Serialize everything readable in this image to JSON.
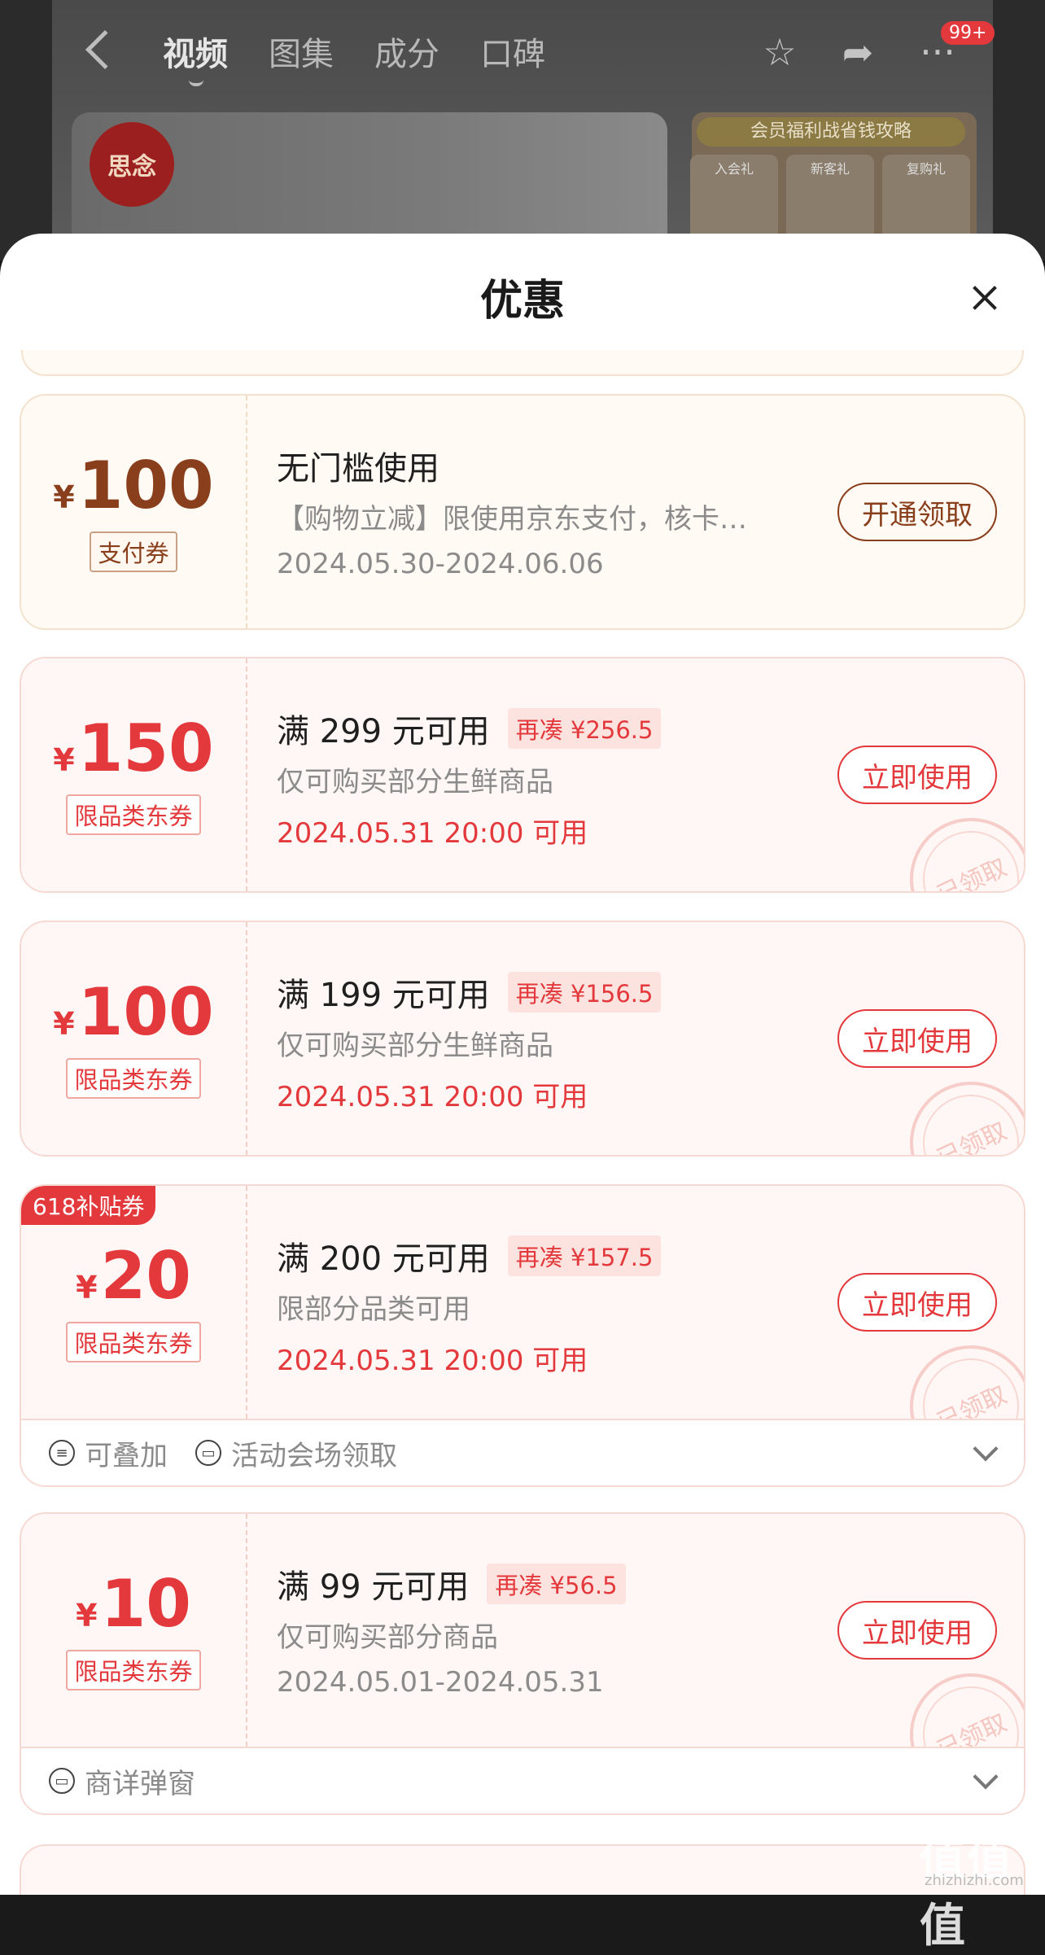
{
  "background_app": {
    "tabs": [
      "视频",
      "图集",
      "成分",
      "口碑"
    ],
    "active_tab": "视频",
    "badge": "99+",
    "logo_text": "思念",
    "banner_title": "会员福利战省钱攻略",
    "mini_cards": [
      "入会礼",
      "新客礼",
      "复购礼"
    ]
  },
  "sheet": {
    "title": "优惠"
  },
  "coupons": [
    {
      "currency": "¥",
      "amount": "100",
      "tag": "支付券",
      "condition": "无门槛使用",
      "desc": "【购物立减】限使用京东支付，核卡…",
      "date": "2024.05.30-2024.06.06",
      "button": "开通领取"
    },
    {
      "currency": "¥",
      "amount": "150",
      "tag": "限品类东券",
      "condition": "满 299 元可用",
      "pill": "再凑 ¥256.5",
      "desc": "仅可购买部分生鲜商品",
      "date": "2024.05.31 20:00 可用",
      "button": "立即使用",
      "stamp": "已领取"
    },
    {
      "currency": "¥",
      "amount": "100",
      "tag": "限品类东券",
      "condition": "满 199 元可用",
      "pill": "再凑 ¥156.5",
      "desc": "仅可购买部分生鲜商品",
      "date": "2024.05.31 20:00 可用",
      "button": "立即使用",
      "stamp": "已领取"
    },
    {
      "corner_tag": "618补贴券",
      "currency": "¥",
      "amount": "20",
      "tag": "限品类东券",
      "condition": "满 200 元可用",
      "pill": "再凑 ¥157.5",
      "desc": "限部分品类可用",
      "date": "2024.05.31 20:00 可用",
      "button": "立即使用",
      "stamp": "已领取",
      "footer": [
        "可叠加",
        "活动会场领取"
      ]
    },
    {
      "currency": "¥",
      "amount": "10",
      "tag": "限品类东券",
      "condition": "满 99 元可用",
      "pill": "再凑 ¥56.5",
      "desc": "仅可购买部分商品",
      "date": "2024.05.01-2024.05.31",
      "button": "立即使用",
      "stamp": "已领取",
      "footer": [
        "商详弹窗"
      ]
    }
  ],
  "watermark": {
    "main": "值值值",
    "sub": "zhizhizhi.com"
  },
  "colors": {
    "accent_red": "#e4393c",
    "pay_brown": "#8a3f1c"
  }
}
